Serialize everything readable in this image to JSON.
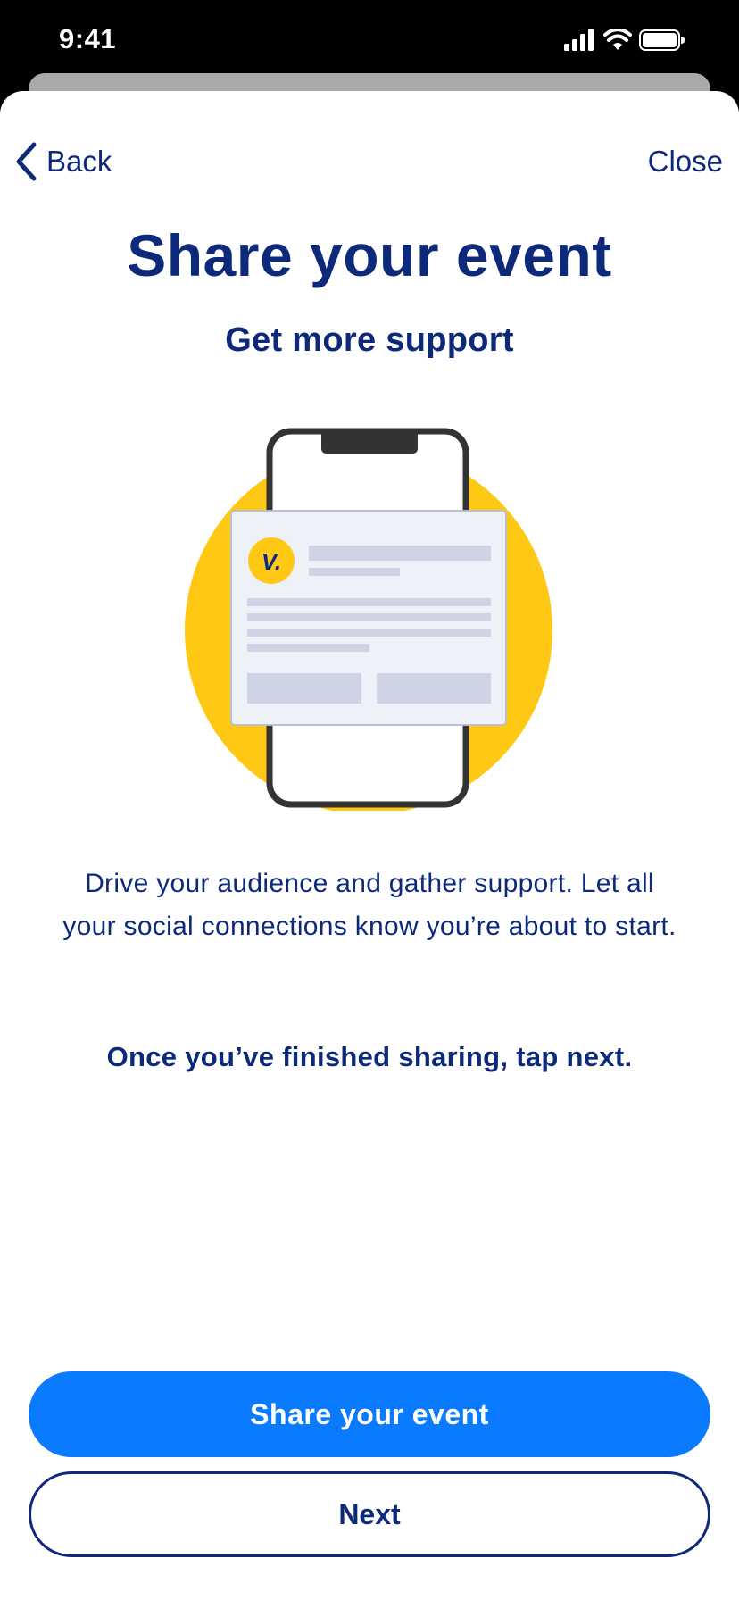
{
  "status_bar": {
    "time": "9:41",
    "icons": [
      "cellular-signal-icon",
      "wifi-icon",
      "battery-icon"
    ]
  },
  "nav": {
    "back_label": "Back",
    "close_label": "Close"
  },
  "content": {
    "title": "Share your event",
    "subtitle": "Get more support",
    "body": "Drive your audience and gather support. Let all your social connections know you’re about to start.",
    "hint": "Once you’ve finished sharing, tap next."
  },
  "illustration": {
    "logo_text": "V.",
    "icons": [
      "phone-icon",
      "share-card-icon"
    ]
  },
  "actions": {
    "primary_label": "Share your event",
    "secondary_label": "Next"
  },
  "colors": {
    "navy": "#0d2a7a",
    "accent_blue": "#0a7bff",
    "yellow": "#ffc814",
    "placeholder": "#ced4e6"
  }
}
